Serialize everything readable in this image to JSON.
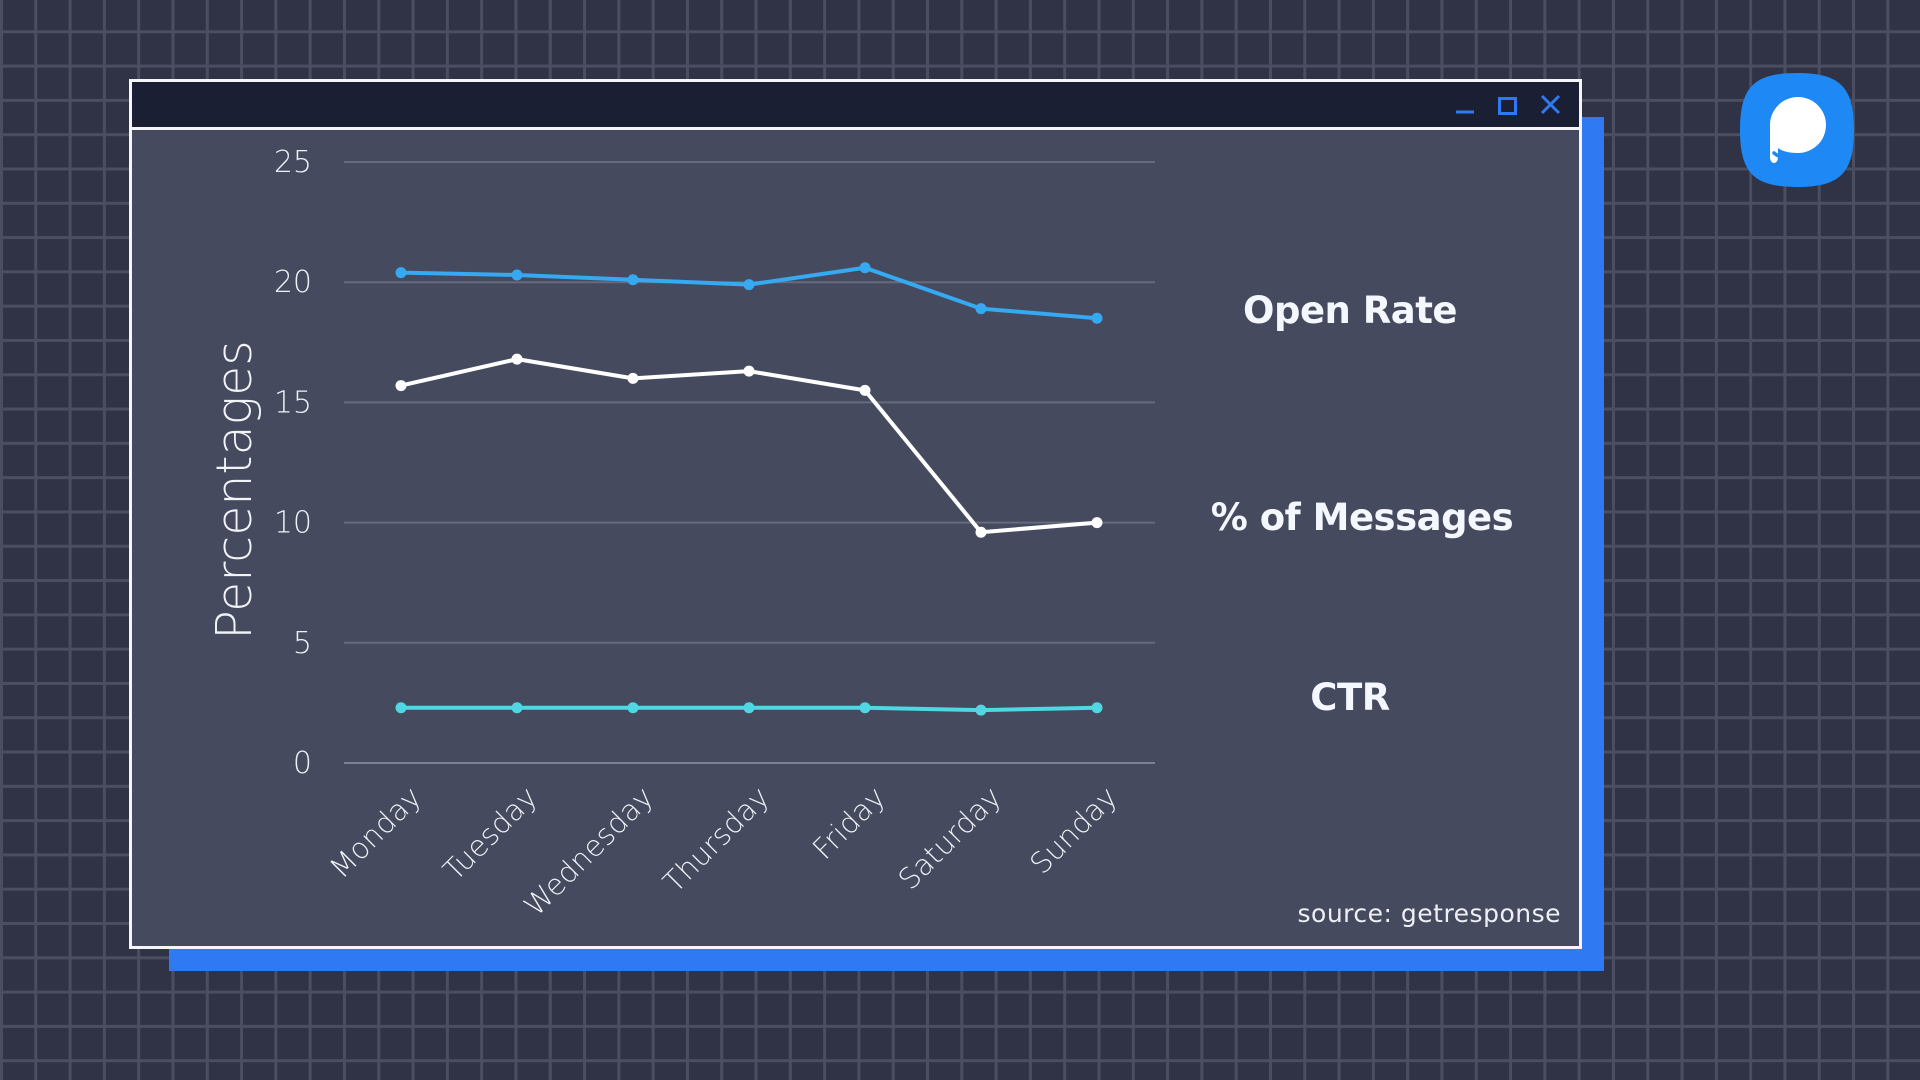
{
  "window": {
    "controls": {
      "minimize": "minimize-icon",
      "maximize": "maximize-icon",
      "close": "close-icon"
    },
    "accent_color": "#2f7af2"
  },
  "logo": {
    "icon": "pitch-logo-icon",
    "color": "#1e88f5"
  },
  "legend_labels": {
    "open_rate": "Open Rate",
    "messages": "% of Messages",
    "ctr": "CTR"
  },
  "source": "source: getresponse",
  "chart_data": {
    "type": "line",
    "title": "",
    "xlabel": "",
    "ylabel": "Percentages",
    "ylim": [
      0,
      25
    ],
    "yticks": [
      0,
      5,
      10,
      15,
      20,
      25
    ],
    "grid": true,
    "legend": "right (labels beside lines)",
    "categories": [
      "Monday",
      "Tuesday",
      "Wednesday",
      "Thursday",
      "Friday",
      "Saturday",
      "Sunday"
    ],
    "series": [
      {
        "name": "Open Rate",
        "color": "#35aaf2",
        "values": [
          20.4,
          20.3,
          20.1,
          19.9,
          20.6,
          18.9,
          18.5
        ]
      },
      {
        "name": "% of Messages",
        "color": "#ffffff",
        "values": [
          15.7,
          16.8,
          16.0,
          16.3,
          15.5,
          9.6,
          10.0
        ]
      },
      {
        "name": "CTR",
        "color": "#4fd8e3",
        "values": [
          2.3,
          2.3,
          2.3,
          2.3,
          2.3,
          2.2,
          2.3
        ]
      }
    ]
  }
}
